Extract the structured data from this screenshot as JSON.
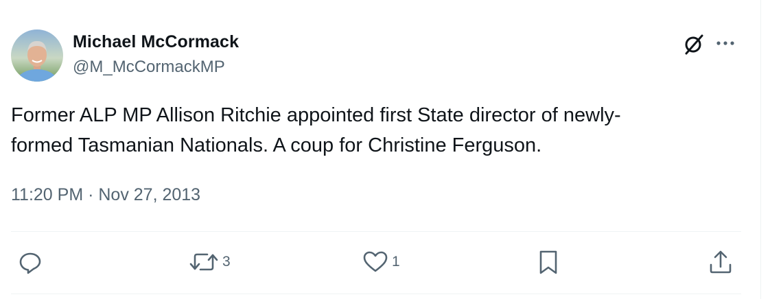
{
  "author": {
    "name": "Michael McCormack",
    "handle": "@M_McCormackMP",
    "avatar": "profile-photo"
  },
  "tweet": {
    "line1": "Former ALP MP Allison Ritchie appointed first State director of newly-",
    "line2": "formed Tasmanian Nationals. A coup for Christine Ferguson.",
    "timestamp": "11:20 PM · Nov 27, 2013"
  },
  "actions": {
    "reply": {
      "icon": "reply-icon",
      "count": ""
    },
    "retweet": {
      "icon": "retweet-icon",
      "count": "3"
    },
    "like": {
      "icon": "heart-icon",
      "count": "1"
    },
    "bookmark": {
      "icon": "bookmark-icon",
      "count": ""
    },
    "share": {
      "icon": "share-icon",
      "count": ""
    }
  },
  "header_icons": [
    "grok-icon",
    "more-icon"
  ],
  "colors": {
    "text": "#0f1419",
    "secondary": "#536471",
    "divider": "#eff3f4"
  }
}
